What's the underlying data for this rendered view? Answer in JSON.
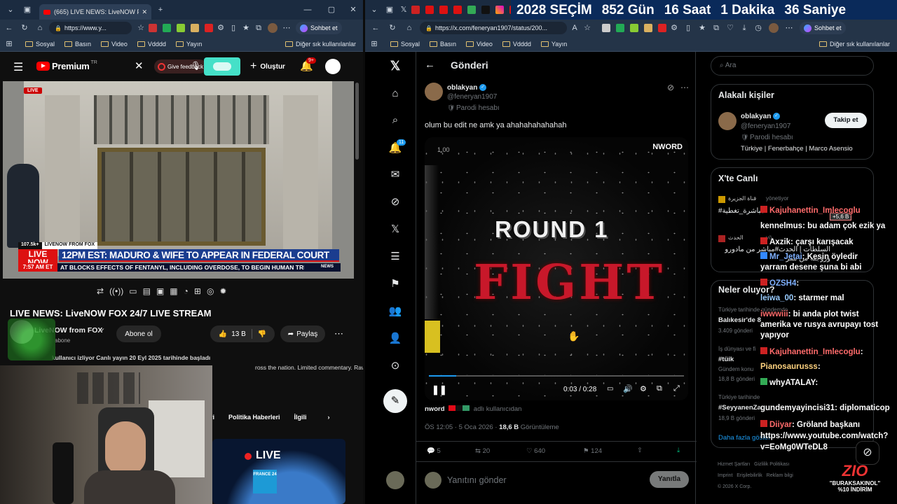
{
  "left_browser": {
    "tab_title": "(665) LIVE NEWS: LiveNOW FOX 2...",
    "url": "https://www.y...",
    "sohbet": "Sohbet et",
    "favorites": [
      "Sosyal",
      "Basın",
      "Video",
      "Vdddd",
      "Yayın"
    ],
    "other_favs": "Diğer sık kullanılanlar"
  },
  "youtube": {
    "logo": "Premium",
    "logo_sup": "TR",
    "give_feedback": "Give feedback",
    "create": "Oluştur",
    "notif_count": "9+",
    "live_badge": "LIVE",
    "video": {
      "viewers": "107.5k+",
      "network_tag": "LIVENOW FROM FOX",
      "headline": "12PM EST: MADURO & WIFE TO APPEAR IN FEDERAL COURT",
      "ticker": "AT BLOCKS EFFECTS OF FENTANYL, INCLUDING OVERDOSE, TO BEGIN HUMAN TRI",
      "time": "7:57 AM ET",
      "live_now": "LIVE NOW",
      "news": "NEWS"
    },
    "title": "LIVE NEWS: LiveNOW FOX 24/7 LIVE STREAM",
    "channel": "LiveNOW from FOX",
    "subs": "abone",
    "subscribe": "Abone ol",
    "likes": "13 B",
    "share": "Paylaş",
    "desc": "kullanıcı izliyor  Canlı yayın 20 Eyl 2025 tarihinde başladı",
    "desc2": "ross the nation. Limited commentary. Raw",
    "chips": [
      "ri",
      "Politika Haberleri",
      "İlgili"
    ],
    "rec_live": "LIVE",
    "rec_channel": "FRANCE 24"
  },
  "right_browser": {
    "url": "https://x.com/feneryan1907/status/200...",
    "sohbet": "Sohbet et",
    "favorites": [
      "Sosyal",
      "Basın",
      "Video",
      "Vdddd",
      "Yayın"
    ],
    "other_favs": "Diğer sık kullanılanlar",
    "countdown": {
      "title": "2028 SEÇİM",
      "days": "852 Gün",
      "hours": "16 Saat",
      "minutes": "1 Dakika",
      "seconds": "36 Saniye"
    }
  },
  "twitter": {
    "nav_badge": "11",
    "header": "Gönderi",
    "author": "oblakyan",
    "handle": "@feneryan1907",
    "parody": "Parodi hesabı",
    "text": "olum bu edit ne amk ya ahahahahahahah",
    "video_speed": "1.00",
    "video_watermark": "NWORD",
    "round": "ROUND 1",
    "fight": "FIGHT",
    "progress": 0.107,
    "time": "0:03 / 0:28",
    "credit_user": "nword",
    "credit_rest": "adlı kullanıcıdan",
    "meta": "ÖS 12:05 · 5 Oca 2026 · ",
    "views": "18,6 B",
    "views_label": "Görüntüleme",
    "actions": {
      "replies": "5",
      "retweets": "20",
      "likes": "640",
      "bookmarks": "124"
    },
    "reply_placeholder": "Yanıtını gönder",
    "reply_button": "Yanıtla",
    "search_placeholder": "Ara",
    "related": {
      "title": "Alakalı kişiler",
      "name": "oblakyan",
      "handle": "@feneryan1907",
      "parody": "Parodi hesabı",
      "bio": "Türkiye | Fenerbahçe | Marco Asensio",
      "follow": "Takip et"
    },
    "live_title": "X'te Canlı",
    "live_items": [
      {
        "name": "قناة الجزيرة",
        "role": "yönetiyor",
        "text": "#مباشرة_تغطية"
      },
      {
        "name": "الحدث",
        "role": "yö",
        "text": "السلطات | الحدث#مباشر من مادورو وزوجته من مقر"
      }
    ],
    "trends_title": "Neler oluyor?",
    "trends": [
      {
        "meta": "Türkiye tarihinde gündemde",
        "name": "Balıkesir'de 8",
        "count": "3.409 gönderi"
      },
      {
        "meta": "İş dünyası ve fi",
        "name": "#tüik",
        "count": "Gündem konu"
      },
      {
        "meta": "18,8 B gönderi",
        "name": "",
        "count": ""
      },
      {
        "meta": "Türkiye tarihinde",
        "name": "#SeyyanenZa",
        "count": "18,9 B gönderi"
      }
    ],
    "show_more": "Daha fazla göster",
    "footer": [
      "Hizmet Şartları",
      "Gizlilik Politikası",
      "Imprint",
      "Erişilebilirlik",
      "Reklam bilgi",
      "© 2026 X Corp."
    ]
  },
  "chat": [
    {
      "user": "Kajuhanettin_Imlecoglu",
      "msg": "",
      "color": "#ff6b6b"
    },
    {
      "user": "kennelmus",
      "msg": "bu adam çok ezik ya",
      "color": "#ffffff"
    },
    {
      "user": "Axzik",
      "msg": "çarşı karışacak",
      "color": "#ffffff"
    },
    {
      "user": "Mr_Jetai",
      "msg": "Kesin öyledir",
      "color": "#7fb0ff"
    },
    {
      "user": "",
      "msg": "yarram desene şuna bi abi",
      "color": "#ffffff"
    },
    {
      "user": "OZSH4",
      "msg": "",
      "color": "#7fb0ff"
    },
    {
      "user": "leiwa_00",
      "msg": "starmer mal",
      "color": "#9cf"
    },
    {
      "user": "iwwwiii",
      "msg": "bi anda plot twist amerika ve rusya avrupayı tost yapıyor",
      "color": "#ff6b6b"
    },
    {
      "user": "Kajuhanettin_Imlecoglu",
      "msg": "",
      "color": "#ff6b6b"
    },
    {
      "user": "Pianosaurusss",
      "msg": "",
      "color": "#ffd27f"
    },
    {
      "user": "whyATALAY",
      "msg": "",
      "color": "#ffffff"
    },
    {
      "user": "gundemyayincisi31",
      "msg": "diplomaticop",
      "color": "#ffffff"
    },
    {
      "user": "Diiyar",
      "msg": "Gröland başkanı https://www.youtube.com/watch?v=EoMg0WTeDL8",
      "color": "#ff6b6b"
    }
  ],
  "chat_badge": "+5,6 B",
  "streamer_logo": {
    "brand": "ZIO",
    "code": "\"BURAKSAKINOL\"",
    "discount": "%10 İNDİRİM"
  }
}
